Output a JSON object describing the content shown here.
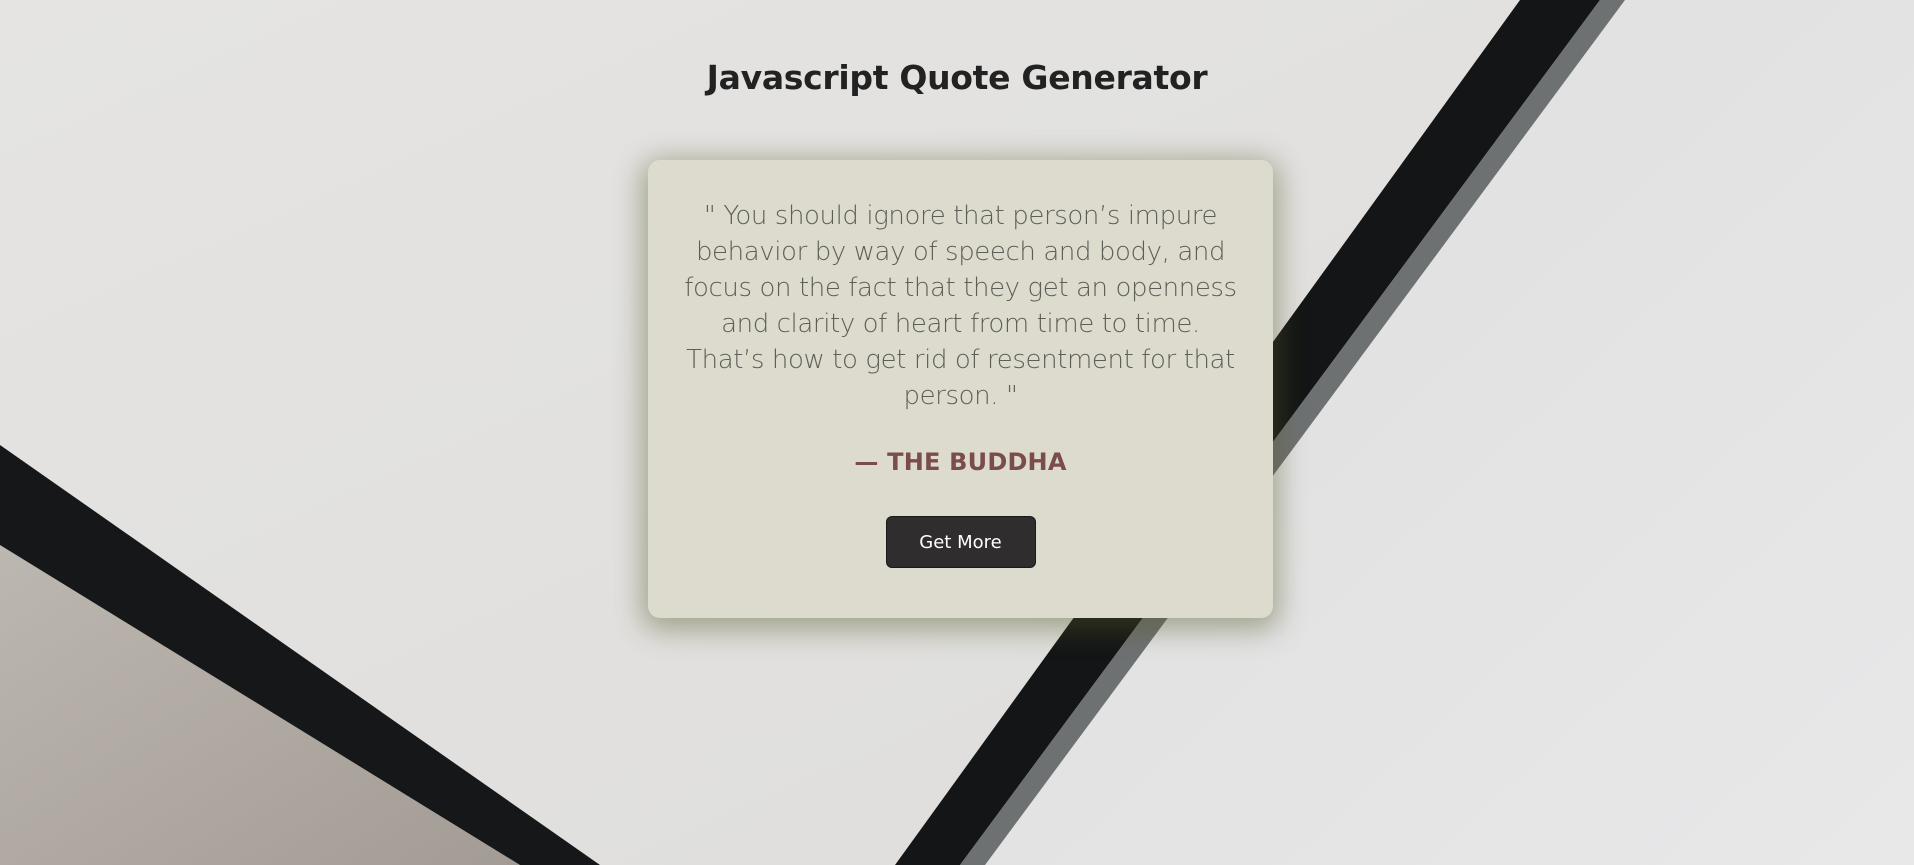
{
  "page": {
    "title": "Javascript Quote Generator"
  },
  "quote": {
    "open_mark": "\"",
    "text": " You should ignore that person’s impure behavior by way of speech and body, and focus on the fact that they get an openness and clarity of heart from time to time. That’s how to get rid of resentment for that person. ",
    "close_mark": "\"",
    "author": "— The Buddha"
  },
  "actions": {
    "get_more_label": "Get More"
  },
  "colors": {
    "card_background": "#dcdbce",
    "author_text": "#7b4c4c",
    "button_background": "#2f2d2d"
  }
}
